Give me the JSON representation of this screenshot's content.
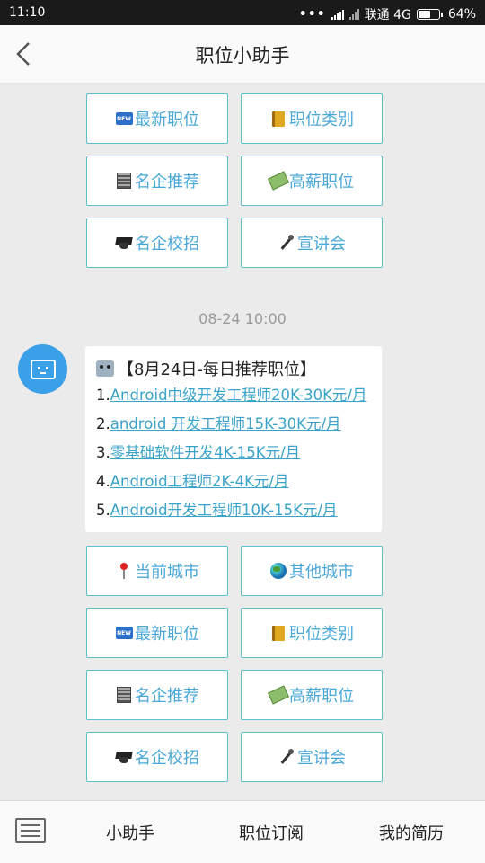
{
  "status_bar": {
    "time": "11:10",
    "carrier": "联通 4G",
    "battery": "64%",
    "battery_level": 0.64
  },
  "header": {
    "title": "职位小助手"
  },
  "top_buttons": [
    {
      "label": "最新职位",
      "icon": "new-icon"
    },
    {
      "label": "职位类别",
      "icon": "book-icon"
    },
    {
      "label": "名企推荐",
      "icon": "building-icon"
    },
    {
      "label": "高薪职位",
      "icon": "money-icon"
    },
    {
      "label": "名企校招",
      "icon": "graduation-cap-icon"
    },
    {
      "label": "宣讲会",
      "icon": "microphone-icon"
    }
  ],
  "message": {
    "timestamp": "08-24 10:00",
    "heading": "【8月24日-每日推荐职位】",
    "jobs": [
      {
        "num": "1.",
        "text": "Android中级开发工程师20K-30K元/月"
      },
      {
        "num": "2.",
        "text": "android 开发工程师15K-30K元/月"
      },
      {
        "num": "3.",
        "text": "零基础软件开发4K-15K元/月"
      },
      {
        "num": "4.",
        "text": "Android工程师2K-4K元/月"
      },
      {
        "num": "5.",
        "text": "Android开发工程师10K-15K元/月"
      }
    ]
  },
  "bottom_buttons": [
    {
      "label": "当前城市",
      "icon": "pin-icon"
    },
    {
      "label": "其他城市",
      "icon": "globe-icon"
    },
    {
      "label": "最新职位",
      "icon": "new-icon"
    },
    {
      "label": "职位类别",
      "icon": "book-icon"
    },
    {
      "label": "名企推荐",
      "icon": "building-icon"
    },
    {
      "label": "高薪职位",
      "icon": "money-icon"
    },
    {
      "label": "名企校招",
      "icon": "graduation-cap-icon"
    },
    {
      "label": "宣讲会",
      "icon": "microphone-icon"
    }
  ],
  "tabbar": {
    "tab1": "小助手",
    "tab2": "职位订阅",
    "tab3": "我的简历"
  },
  "colors": {
    "accent": "#4aa8d8",
    "border": "#5dc0cb",
    "link": "#3aa3c9",
    "avatar": "#3aa0e8"
  }
}
